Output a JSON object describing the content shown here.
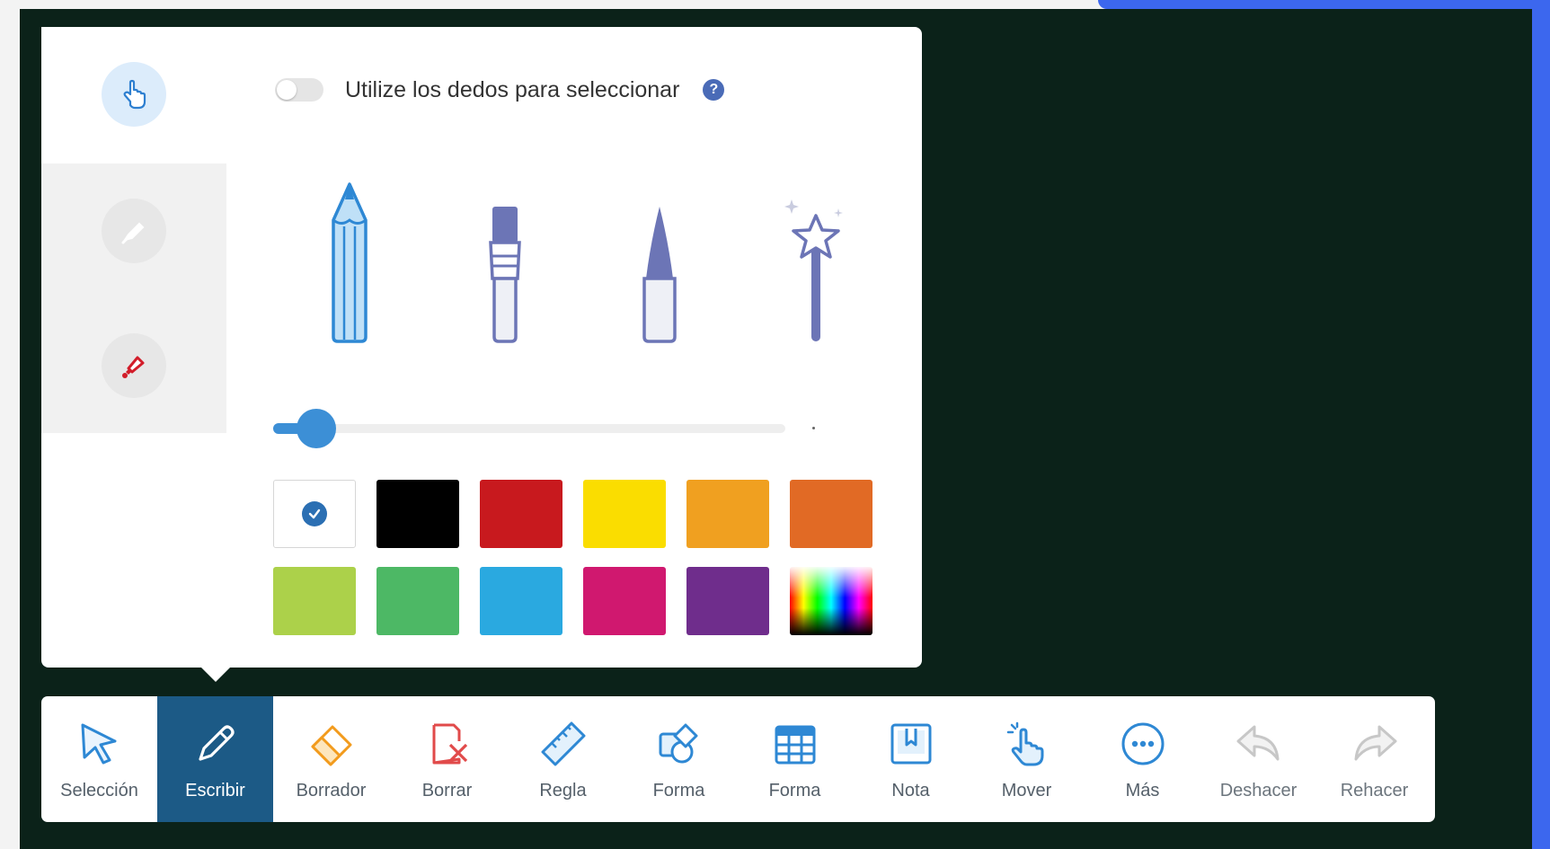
{
  "popover": {
    "finger_toggle": {
      "label": "Utilize los dedos para seleccionar",
      "enabled": false,
      "help_icon": "question-icon"
    },
    "side_tabs": [
      {
        "icon": "hand-pointer-icon",
        "selected": true
      },
      {
        "icon": "highlighter-icon",
        "selected": false
      },
      {
        "icon": "marker-icon",
        "selected": false
      }
    ],
    "pens": [
      "pencil",
      "brush",
      "nib-pen",
      "magic-wand"
    ],
    "stroke_width": {
      "value_fraction": 0.05
    },
    "colors": {
      "selected": "#ffffff",
      "palette": [
        "#ffffff",
        "#000000",
        "#c8191e",
        "#fadd00",
        "#f0a020",
        "#e16a25",
        "#acd14a",
        "#4db865",
        "#2aa9e0",
        "#d0186f",
        "#6f2d8c",
        "gradient"
      ]
    }
  },
  "toolbar": {
    "active": "Escribir",
    "items": [
      {
        "label": "Selección",
        "icon": "cursor-arrow-icon"
      },
      {
        "label": "Escribir",
        "icon": "pen-icon"
      },
      {
        "label": "Borrador",
        "icon": "eraser-icon"
      },
      {
        "label": "Borrar",
        "icon": "clear-page-icon"
      },
      {
        "label": "Regla",
        "icon": "ruler-icon"
      },
      {
        "label": "Forma",
        "icon": "shapes-icon"
      },
      {
        "label": "Forma",
        "icon": "table-icon"
      },
      {
        "label": "Nota",
        "icon": "note-icon"
      },
      {
        "label": "Mover",
        "icon": "move-hand-icon"
      },
      {
        "label": "Más",
        "icon": "more-icon"
      },
      {
        "label": "Deshacer",
        "icon": "undo-icon"
      },
      {
        "label": "Rehacer",
        "icon": "redo-icon"
      }
    ]
  },
  "theme": {
    "board": "#0b2219",
    "accent": "#3c8fd6",
    "toolbar_active": "#1c5a86",
    "icon": "#2e88d4"
  }
}
